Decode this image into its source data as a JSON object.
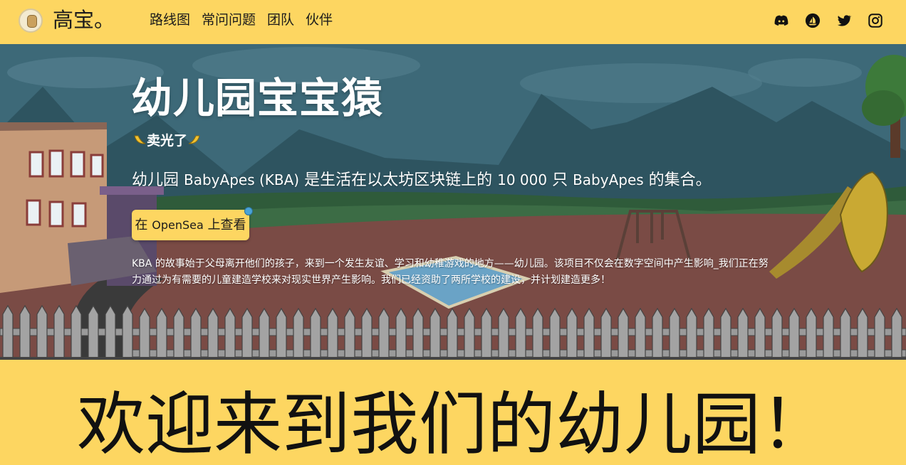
{
  "nav": {
    "logo_text": "高宝。",
    "menu": [
      {
        "label": "路线图"
      },
      {
        "label": "常问问题"
      },
      {
        "label": "团队"
      },
      {
        "label": "伙伴"
      }
    ],
    "socials": [
      {
        "icon": "discord-icon"
      },
      {
        "icon": "opensea-icon"
      },
      {
        "icon": "twitter-icon"
      },
      {
        "icon": "instagram-icon"
      }
    ]
  },
  "hero": {
    "title": "幼儿园宝宝猿",
    "sold_text": "卖光了",
    "subtitle_pre": "幼儿园 ",
    "subtitle_brand1": "BabyApes (KBA)",
    "subtitle_mid": " 是生活在以太坊区块链上的 ",
    "subtitle_count": "10 000",
    "subtitle_mid2": " 只 ",
    "subtitle_brand2": "BabyApes",
    "subtitle_post": " 的集合。",
    "button_pre": "在 ",
    "button_brand": "OpenSea",
    "button_post": " 上查看",
    "description": "KBA 的故事始于父母离开他们的孩子，来到一个发生友谊、学习和幼稚游戏的地方——幼儿园。该项目不仅会在数字空间中产生影响_我们正在努力通过为有需要的儿童建造学校来对现实世界产生影响。我们已经资助了两所学校的建设，并计划建造更多！"
  },
  "welcome": {
    "title": "欢迎来到我们的幼儿园！"
  },
  "colors": {
    "accent": "#fdd661",
    "sky": "#3f6b7a",
    "ground": "#7a4b45",
    "grass": "#355a3b",
    "fence": "#8c8c8c"
  }
}
